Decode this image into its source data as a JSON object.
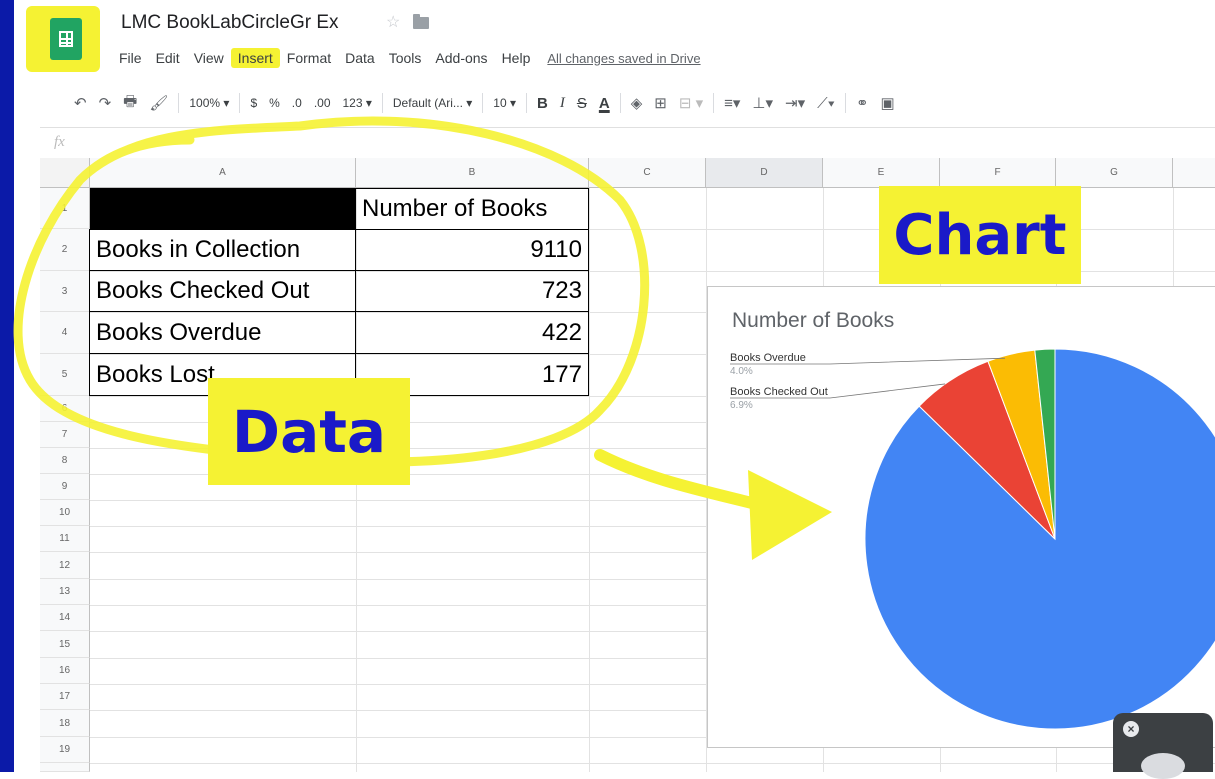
{
  "app": {
    "title": "LMC BookLabCircleGr Ex",
    "menu": [
      "File",
      "Edit",
      "View",
      "Insert",
      "Format",
      "Data",
      "Tools",
      "Add-ons",
      "Help"
    ],
    "saved_status": "All changes saved in Drive",
    "highlighted_menu": "Insert",
    "accent": "#21a462",
    "highlight_color": "#f5f233"
  },
  "toolbar": {
    "zoom": "100%",
    "currency": "$",
    "percent": "%",
    "decrease_decimal": ".0",
    "increase_decimal": ".00",
    "more_formats": "123",
    "font": "Default (Ari...",
    "font_size": "10",
    "bold": "B",
    "italic": "I",
    "strike": "S",
    "text_color": "A"
  },
  "formula_bar": {
    "fx": "fx"
  },
  "columns": [
    "A",
    "B",
    "C",
    "D",
    "E",
    "F",
    "G"
  ],
  "rows": [
    "1",
    "2",
    "3",
    "4",
    "5",
    "6",
    "7",
    "8",
    "9",
    "10",
    "11",
    "12",
    "13",
    "14",
    "15",
    "16",
    "17",
    "18",
    "19"
  ],
  "table": {
    "header": "Number of Books",
    "rows": [
      {
        "label": "Books in Collection",
        "value": "9110"
      },
      {
        "label": "Books Checked Out",
        "value": "723"
      },
      {
        "label": "Books Overdue",
        "value": "422"
      },
      {
        "label": "Books Lost",
        "value": "177"
      }
    ]
  },
  "annotations": {
    "data_label": "Data",
    "chart_label": "Chart",
    "text_color": "#1a1ac8"
  },
  "chart_data": {
    "type": "pie",
    "title": "Number of Books",
    "slices": [
      {
        "label": "Books in Collection",
        "value": 9110,
        "color": "#4285f4"
      },
      {
        "label": "Books Checked Out",
        "value": 723,
        "color": "#ea4335",
        "pct_label": "6.9%"
      },
      {
        "label": "Books Overdue",
        "value": 422,
        "color": "#fbbc04",
        "pct_label": "4.0%"
      },
      {
        "label": "Books Lost",
        "value": 177,
        "color": "#34a853"
      }
    ]
  }
}
